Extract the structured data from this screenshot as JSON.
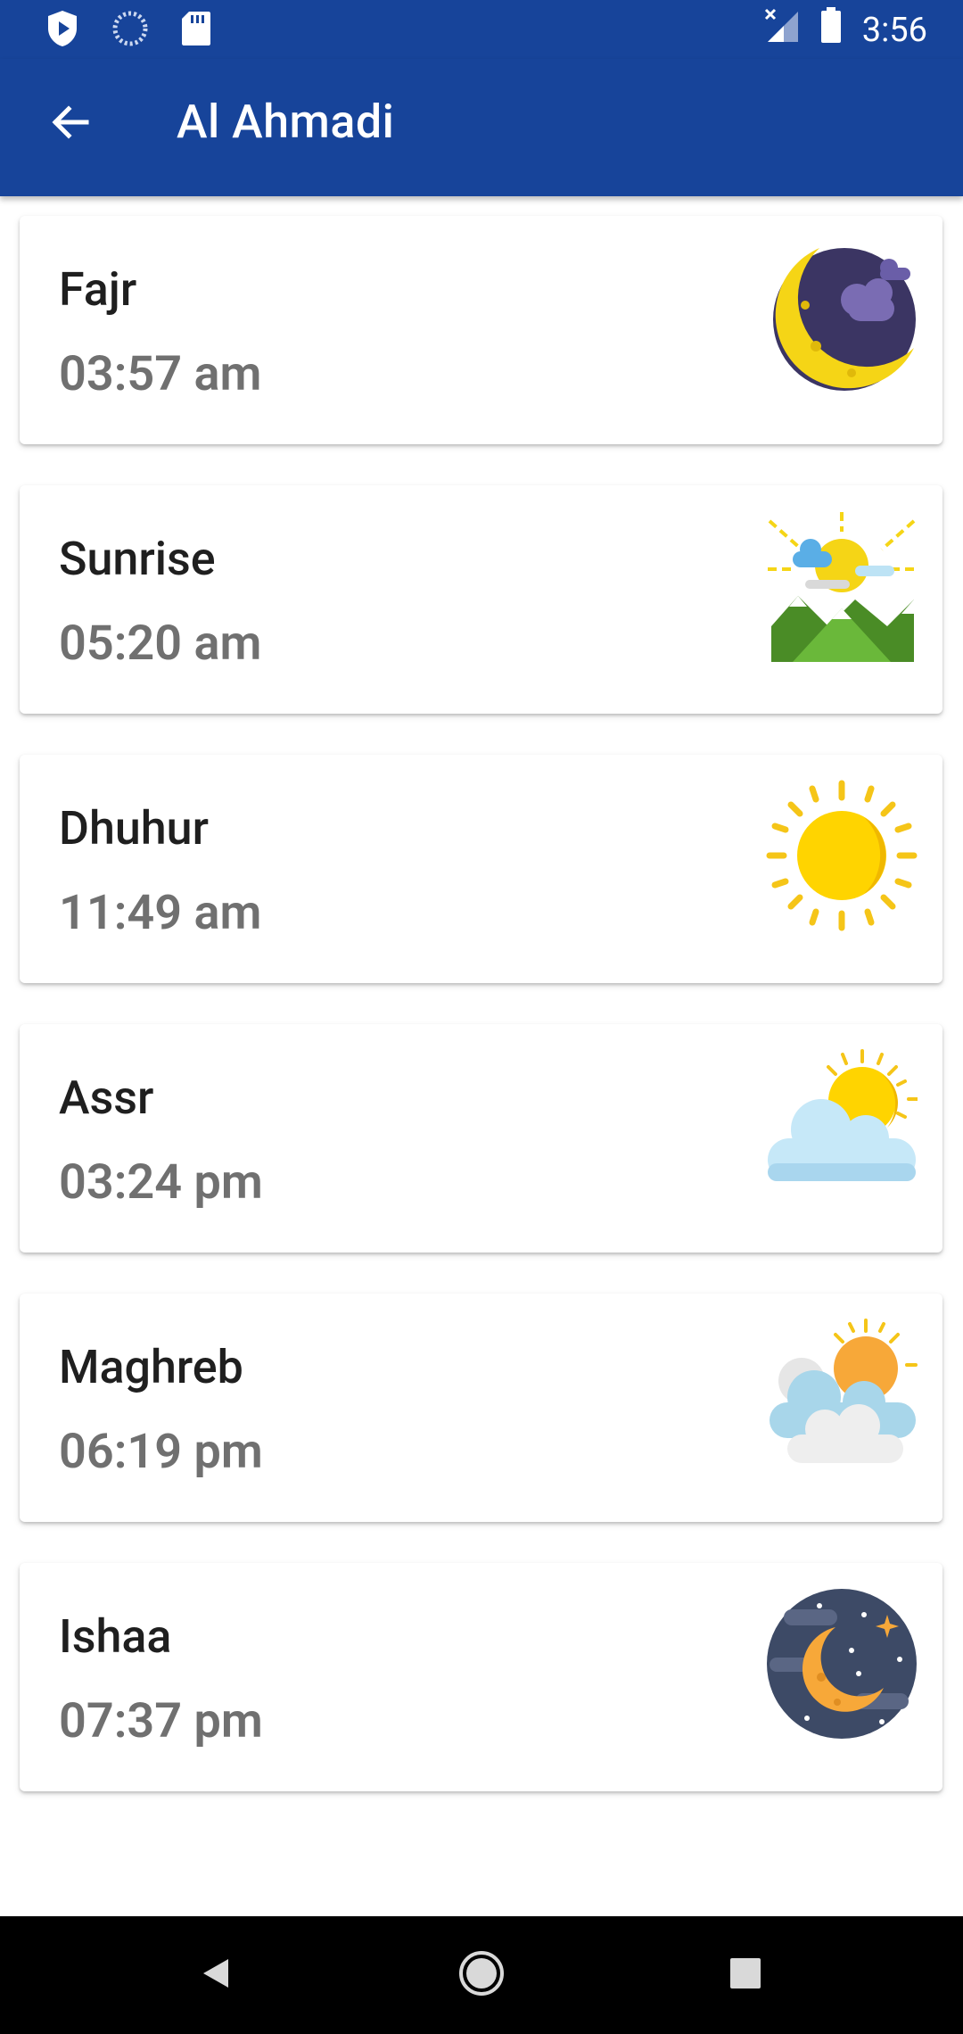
{
  "status_bar": {
    "time": "3:56",
    "icons": [
      "shield-icon",
      "sync-icon",
      "sd-card-icon",
      "signal-icon",
      "battery-icon"
    ]
  },
  "app_bar": {
    "title": "Al Ahmadi",
    "back_icon": "arrow-left-icon"
  },
  "prayers": [
    {
      "name": "Fajr",
      "time": "03:57 am",
      "icon": "moon-clouds-icon"
    },
    {
      "name": "Sunrise",
      "time": "05:20 am",
      "icon": "sunrise-mountains-icon"
    },
    {
      "name": "Dhuhur",
      "time": "11:49 am",
      "icon": "sun-icon"
    },
    {
      "name": "Assr",
      "time": "03:24 pm",
      "icon": "sun-cloud-icon"
    },
    {
      "name": "Maghreb",
      "time": "06:19 pm",
      "icon": "sun-clouds-icon"
    },
    {
      "name": "Ishaa",
      "time": "07:37 pm",
      "icon": "night-moon-icon"
    }
  ],
  "nav_bar": {
    "back": "nav-back-icon",
    "home": "nav-home-icon",
    "recents": "nav-recents-icon"
  },
  "colors": {
    "primary": "#17449a",
    "name_text": "#1f1f1f",
    "time_text": "#707070"
  }
}
